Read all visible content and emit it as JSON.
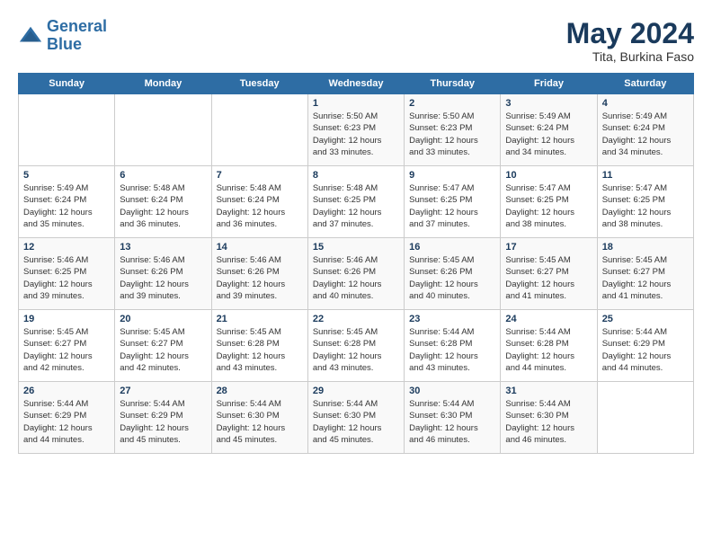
{
  "header": {
    "logo_line1": "General",
    "logo_line2": "Blue",
    "month_year": "May 2024",
    "location": "Tita, Burkina Faso"
  },
  "weekdays": [
    "Sunday",
    "Monday",
    "Tuesday",
    "Wednesday",
    "Thursday",
    "Friday",
    "Saturday"
  ],
  "weeks": [
    [
      {
        "day": "",
        "info": ""
      },
      {
        "day": "",
        "info": ""
      },
      {
        "day": "",
        "info": ""
      },
      {
        "day": "1",
        "info": "Sunrise: 5:50 AM\nSunset: 6:23 PM\nDaylight: 12 hours\nand 33 minutes."
      },
      {
        "day": "2",
        "info": "Sunrise: 5:50 AM\nSunset: 6:23 PM\nDaylight: 12 hours\nand 33 minutes."
      },
      {
        "day": "3",
        "info": "Sunrise: 5:49 AM\nSunset: 6:24 PM\nDaylight: 12 hours\nand 34 minutes."
      },
      {
        "day": "4",
        "info": "Sunrise: 5:49 AM\nSunset: 6:24 PM\nDaylight: 12 hours\nand 34 minutes."
      }
    ],
    [
      {
        "day": "5",
        "info": "Sunrise: 5:49 AM\nSunset: 6:24 PM\nDaylight: 12 hours\nand 35 minutes."
      },
      {
        "day": "6",
        "info": "Sunrise: 5:48 AM\nSunset: 6:24 PM\nDaylight: 12 hours\nand 36 minutes."
      },
      {
        "day": "7",
        "info": "Sunrise: 5:48 AM\nSunset: 6:24 PM\nDaylight: 12 hours\nand 36 minutes."
      },
      {
        "day": "8",
        "info": "Sunrise: 5:48 AM\nSunset: 6:25 PM\nDaylight: 12 hours\nand 37 minutes."
      },
      {
        "day": "9",
        "info": "Sunrise: 5:47 AM\nSunset: 6:25 PM\nDaylight: 12 hours\nand 37 minutes."
      },
      {
        "day": "10",
        "info": "Sunrise: 5:47 AM\nSunset: 6:25 PM\nDaylight: 12 hours\nand 38 minutes."
      },
      {
        "day": "11",
        "info": "Sunrise: 5:47 AM\nSunset: 6:25 PM\nDaylight: 12 hours\nand 38 minutes."
      }
    ],
    [
      {
        "day": "12",
        "info": "Sunrise: 5:46 AM\nSunset: 6:25 PM\nDaylight: 12 hours\nand 39 minutes."
      },
      {
        "day": "13",
        "info": "Sunrise: 5:46 AM\nSunset: 6:26 PM\nDaylight: 12 hours\nand 39 minutes."
      },
      {
        "day": "14",
        "info": "Sunrise: 5:46 AM\nSunset: 6:26 PM\nDaylight: 12 hours\nand 39 minutes."
      },
      {
        "day": "15",
        "info": "Sunrise: 5:46 AM\nSunset: 6:26 PM\nDaylight: 12 hours\nand 40 minutes."
      },
      {
        "day": "16",
        "info": "Sunrise: 5:45 AM\nSunset: 6:26 PM\nDaylight: 12 hours\nand 40 minutes."
      },
      {
        "day": "17",
        "info": "Sunrise: 5:45 AM\nSunset: 6:27 PM\nDaylight: 12 hours\nand 41 minutes."
      },
      {
        "day": "18",
        "info": "Sunrise: 5:45 AM\nSunset: 6:27 PM\nDaylight: 12 hours\nand 41 minutes."
      }
    ],
    [
      {
        "day": "19",
        "info": "Sunrise: 5:45 AM\nSunset: 6:27 PM\nDaylight: 12 hours\nand 42 minutes."
      },
      {
        "day": "20",
        "info": "Sunrise: 5:45 AM\nSunset: 6:27 PM\nDaylight: 12 hours\nand 42 minutes."
      },
      {
        "day": "21",
        "info": "Sunrise: 5:45 AM\nSunset: 6:28 PM\nDaylight: 12 hours\nand 43 minutes."
      },
      {
        "day": "22",
        "info": "Sunrise: 5:45 AM\nSunset: 6:28 PM\nDaylight: 12 hours\nand 43 minutes."
      },
      {
        "day": "23",
        "info": "Sunrise: 5:44 AM\nSunset: 6:28 PM\nDaylight: 12 hours\nand 43 minutes."
      },
      {
        "day": "24",
        "info": "Sunrise: 5:44 AM\nSunset: 6:28 PM\nDaylight: 12 hours\nand 44 minutes."
      },
      {
        "day": "25",
        "info": "Sunrise: 5:44 AM\nSunset: 6:29 PM\nDaylight: 12 hours\nand 44 minutes."
      }
    ],
    [
      {
        "day": "26",
        "info": "Sunrise: 5:44 AM\nSunset: 6:29 PM\nDaylight: 12 hours\nand 44 minutes."
      },
      {
        "day": "27",
        "info": "Sunrise: 5:44 AM\nSunset: 6:29 PM\nDaylight: 12 hours\nand 45 minutes."
      },
      {
        "day": "28",
        "info": "Sunrise: 5:44 AM\nSunset: 6:30 PM\nDaylight: 12 hours\nand 45 minutes."
      },
      {
        "day": "29",
        "info": "Sunrise: 5:44 AM\nSunset: 6:30 PM\nDaylight: 12 hours\nand 45 minutes."
      },
      {
        "day": "30",
        "info": "Sunrise: 5:44 AM\nSunset: 6:30 PM\nDaylight: 12 hours\nand 46 minutes."
      },
      {
        "day": "31",
        "info": "Sunrise: 5:44 AM\nSunset: 6:30 PM\nDaylight: 12 hours\nand 46 minutes."
      },
      {
        "day": "",
        "info": ""
      }
    ]
  ]
}
